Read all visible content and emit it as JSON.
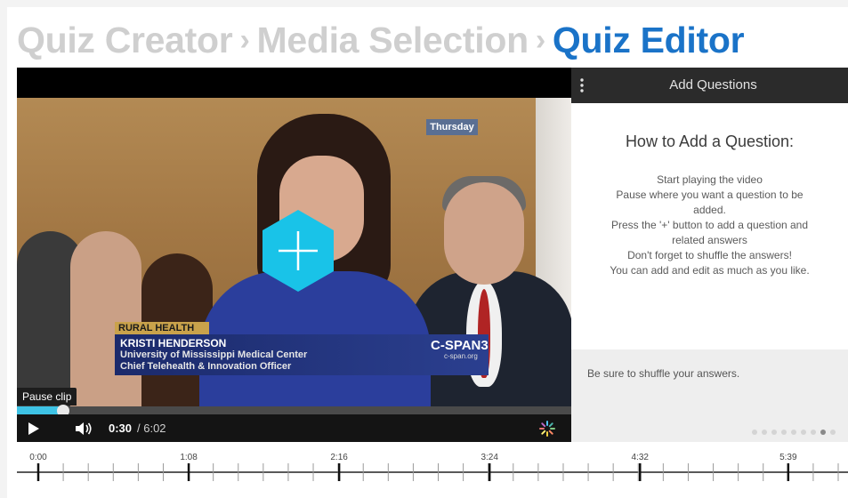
{
  "breadcrumb": {
    "steps": [
      {
        "label": "Quiz Creator",
        "state": "inactive"
      },
      {
        "label": "Media Selection",
        "state": "inactive"
      },
      {
        "label": "Quiz Editor",
        "state": "active"
      }
    ],
    "separator": "›"
  },
  "colors": {
    "accent": "#1a73c8",
    "inactive": "#cfcfcf",
    "progress": "#3ec3e5",
    "hex_button": "#19c3e8"
  },
  "video": {
    "overlay": {
      "day_badge": "Thursday",
      "topic_tag": "RURAL HEALTH",
      "name": "KRISTI HENDERSON",
      "affiliation": "University of Mississippi Medical Center",
      "role": "Chief Telehealth & Innovation Officer",
      "network": "C-SPAN3",
      "network_url": "c-span.org"
    },
    "pause_clip_label": "Pause clip",
    "time_current": "0:30",
    "time_total": "/ 6:02",
    "progress_fraction": 0.083,
    "icons": {
      "add": "plus-hexagon-icon",
      "play": "play-icon",
      "volume": "volume-icon",
      "loading": "spinner-icon"
    }
  },
  "questions_panel": {
    "title": "Add Questions",
    "heading": "How to Add a Question:",
    "instructions": [
      "Start playing the video",
      "Pause where you want a question to be added.",
      "Press the '+' button to add a question and related answers",
      "Don't forget to shuffle the answers!",
      "You can add and edit as much as you like."
    ],
    "tip": "Be sure to shuffle your answers.",
    "tip_pages": 9,
    "active_tip_index": 7
  },
  "timeline": {
    "duration_seconds": 362,
    "labels": [
      "0:00",
      "1:08",
      "2:16",
      "3:24",
      "4:32",
      "5:39"
    ],
    "label_seconds": [
      0,
      68,
      136,
      204,
      272,
      339
    ]
  }
}
